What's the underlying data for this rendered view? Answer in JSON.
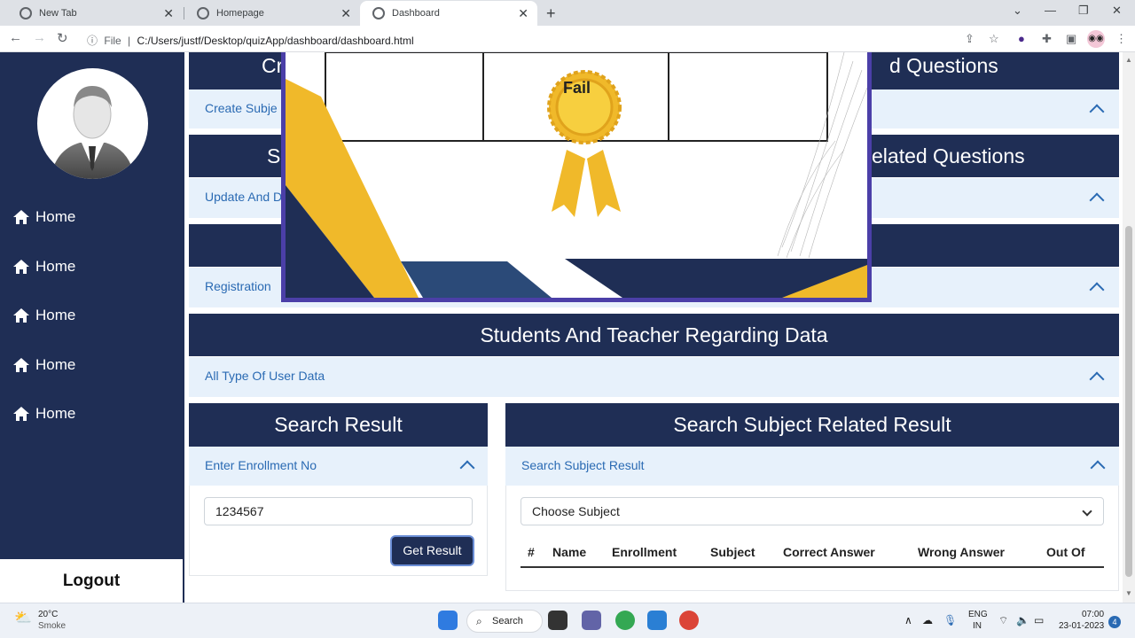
{
  "browser": {
    "tabs": [
      {
        "title": "New Tab"
      },
      {
        "title": "Homepage"
      },
      {
        "title": "Dashboard"
      }
    ],
    "url_prefix": "File",
    "url": "C:/Users/justf/Desktop/quizApp/dashboard/dashboard.html"
  },
  "sidebar": {
    "items": [
      {
        "label": "Home"
      },
      {
        "label": "Home"
      },
      {
        "label": "Home"
      },
      {
        "label": "Home"
      },
      {
        "label": "Home"
      }
    ],
    "logout_label": "Logout"
  },
  "main": {
    "sections": [
      {
        "header_left": "Cr",
        "header_right": "d Questions",
        "body_text": "Create Subje"
      },
      {
        "header_left": "S",
        "header_right": "elated Questions",
        "body_text": "Update And D"
      },
      {
        "header_left": "",
        "header_right": "",
        "body_text": "Registration"
      },
      {
        "header": "Students And Teacher Regarding Data",
        "body_text": "All Type Of User Data"
      }
    ],
    "search_result": {
      "header": "Search Result",
      "body_text": "Enter Enrollment No",
      "input_value": "1234567",
      "button_label": "Get Result"
    },
    "subject_result": {
      "header": "Search Subject Related Result",
      "body_text": "Search Subject Result",
      "select_value": "Choose Subject",
      "table_headers": [
        "#",
        "Name",
        "Enrollment",
        "Subject",
        "Correct Answer",
        "Wrong Answer",
        "Out Of"
      ]
    }
  },
  "modal": {
    "certificate_label": "Fail"
  },
  "taskbar": {
    "weather_temp": "20°C",
    "weather_desc": "Smoke",
    "search_label": "Search",
    "lang": "ENG",
    "region": "IN",
    "time": "07:00",
    "date": "23-01-2023",
    "notification_count": "4"
  },
  "colors": {
    "navy": "#1f2e55",
    "accordion_bg": "#e7f1fb",
    "link_blue": "#2a6ab3",
    "gold": "#f0b92a"
  }
}
